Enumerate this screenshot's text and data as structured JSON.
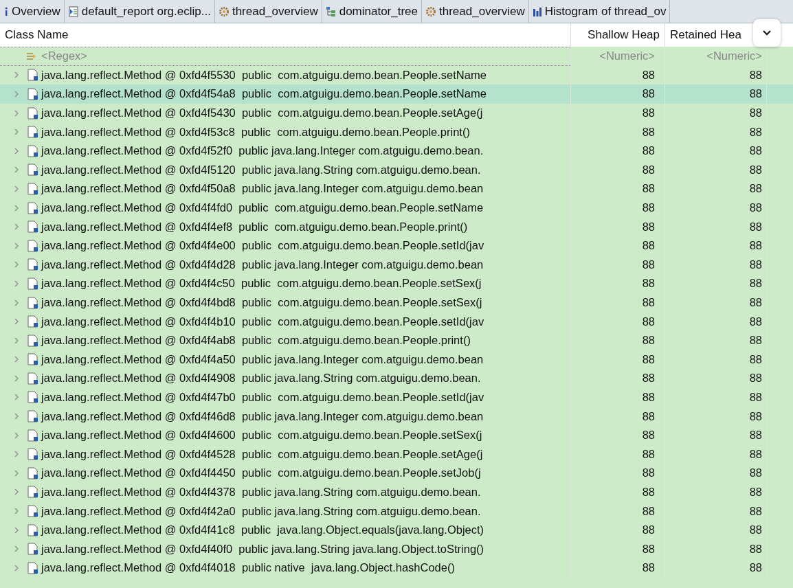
{
  "tabs": [
    {
      "label": "Overview",
      "kind": "info",
      "selected": false
    },
    {
      "label": "default_report  org.eclip...",
      "kind": "report",
      "selected": false
    },
    {
      "label": "thread_overview",
      "kind": "thread",
      "selected": false
    },
    {
      "label": "dominator_tree",
      "kind": "tree",
      "selected": false
    },
    {
      "label": "thread_overview",
      "kind": "thread",
      "selected": false
    },
    {
      "label": "Histogram of thread_ov",
      "kind": "histogram",
      "selected": false
    }
  ],
  "table": {
    "columns": [
      "Class Name",
      "Shallow Heap",
      "Retained Hea"
    ],
    "filter": {
      "class_placeholder": "<Regex>",
      "shallow_placeholder": "<Numeric>",
      "retained_placeholder": "<Numeric>"
    },
    "rows": [
      {
        "name": "java.lang.reflect.Method @ 0xfd4f5530  public  com.atguigu.demo.bean.People.setName",
        "shallow": "88",
        "retained": "88",
        "selected": false
      },
      {
        "name": "java.lang.reflect.Method @ 0xfd4f54a8  public  com.atguigu.demo.bean.People.setName",
        "shallow": "88",
        "retained": "88",
        "selected": true
      },
      {
        "name": "java.lang.reflect.Method @ 0xfd4f5430  public  com.atguigu.demo.bean.People.setAge(j",
        "shallow": "88",
        "retained": "88",
        "selected": false
      },
      {
        "name": "java.lang.reflect.Method @ 0xfd4f53c8  public  com.atguigu.demo.bean.People.print()",
        "shallow": "88",
        "retained": "88",
        "selected": false
      },
      {
        "name": "java.lang.reflect.Method @ 0xfd4f52f0  public java.lang.Integer com.atguigu.demo.bean.",
        "shallow": "88",
        "retained": "88",
        "selected": false
      },
      {
        "name": "java.lang.reflect.Method @ 0xfd4f5120  public java.lang.String com.atguigu.demo.bean.",
        "shallow": "88",
        "retained": "88",
        "selected": false
      },
      {
        "name": "java.lang.reflect.Method @ 0xfd4f50a8  public java.lang.Integer com.atguigu.demo.bean",
        "shallow": "88",
        "retained": "88",
        "selected": false
      },
      {
        "name": "java.lang.reflect.Method @ 0xfd4f4fd0  public  com.atguigu.demo.bean.People.setName",
        "shallow": "88",
        "retained": "88",
        "selected": false
      },
      {
        "name": "java.lang.reflect.Method @ 0xfd4f4ef8  public  com.atguigu.demo.bean.People.print()",
        "shallow": "88",
        "retained": "88",
        "selected": false
      },
      {
        "name": "java.lang.reflect.Method @ 0xfd4f4e00  public  com.atguigu.demo.bean.People.setId(jav",
        "shallow": "88",
        "retained": "88",
        "selected": false
      },
      {
        "name": "java.lang.reflect.Method @ 0xfd4f4d28  public java.lang.Integer com.atguigu.demo.bean",
        "shallow": "88",
        "retained": "88",
        "selected": false
      },
      {
        "name": "java.lang.reflect.Method @ 0xfd4f4c50  public  com.atguigu.demo.bean.People.setSex(j",
        "shallow": "88",
        "retained": "88",
        "selected": false
      },
      {
        "name": "java.lang.reflect.Method @ 0xfd4f4bd8  public  com.atguigu.demo.bean.People.setSex(j",
        "shallow": "88",
        "retained": "88",
        "selected": false
      },
      {
        "name": "java.lang.reflect.Method @ 0xfd4f4b10  public  com.atguigu.demo.bean.People.setId(jav",
        "shallow": "88",
        "retained": "88",
        "selected": false
      },
      {
        "name": "java.lang.reflect.Method @ 0xfd4f4ab8  public  com.atguigu.demo.bean.People.print()",
        "shallow": "88",
        "retained": "88",
        "selected": false
      },
      {
        "name": "java.lang.reflect.Method @ 0xfd4f4a50  public java.lang.Integer com.atguigu.demo.bean",
        "shallow": "88",
        "retained": "88",
        "selected": false
      },
      {
        "name": "java.lang.reflect.Method @ 0xfd4f4908  public java.lang.String com.atguigu.demo.bean.",
        "shallow": "88",
        "retained": "88",
        "selected": false
      },
      {
        "name": "java.lang.reflect.Method @ 0xfd4f47b0  public  com.atguigu.demo.bean.People.setId(jav",
        "shallow": "88",
        "retained": "88",
        "selected": false
      },
      {
        "name": "java.lang.reflect.Method @ 0xfd4f46d8  public java.lang.Integer com.atguigu.demo.bean",
        "shallow": "88",
        "retained": "88",
        "selected": false
      },
      {
        "name": "java.lang.reflect.Method @ 0xfd4f4600  public  com.atguigu.demo.bean.People.setSex(j",
        "shallow": "88",
        "retained": "88",
        "selected": false
      },
      {
        "name": "java.lang.reflect.Method @ 0xfd4f4528  public  com.atguigu.demo.bean.People.setAge(j",
        "shallow": "88",
        "retained": "88",
        "selected": false
      },
      {
        "name": "java.lang.reflect.Method @ 0xfd4f4450  public  com.atguigu.demo.bean.People.setJob(j",
        "shallow": "88",
        "retained": "88",
        "selected": false
      },
      {
        "name": "java.lang.reflect.Method @ 0xfd4f4378  public java.lang.String com.atguigu.demo.bean.",
        "shallow": "88",
        "retained": "88",
        "selected": false
      },
      {
        "name": "java.lang.reflect.Method @ 0xfd4f42a0  public java.lang.String com.atguigu.demo.bean.",
        "shallow": "88",
        "retained": "88",
        "selected": false
      },
      {
        "name": "java.lang.reflect.Method @ 0xfd4f41c8  public  java.lang.Object.equals(java.lang.Object)",
        "shallow": "88",
        "retained": "88",
        "selected": false
      },
      {
        "name": "java.lang.reflect.Method @ 0xfd4f40f0  public java.lang.String java.lang.Object.toString()",
        "shallow": "88",
        "retained": "88",
        "selected": false
      },
      {
        "name": "java.lang.reflect.Method @ 0xfd4f4018  public native  java.lang.Object.hashCode()",
        "shallow": "88",
        "retained": "88",
        "selected": false
      }
    ]
  }
}
